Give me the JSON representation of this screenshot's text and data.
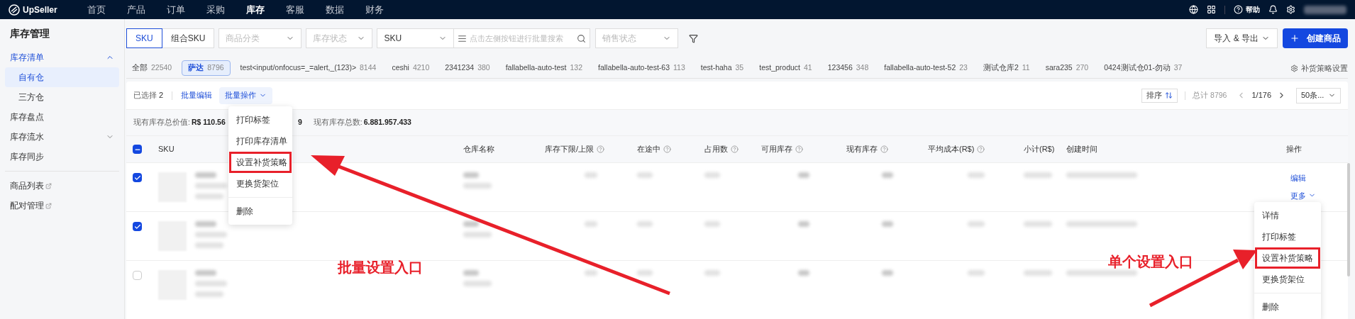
{
  "nav": {
    "logo": "UpSeller",
    "items": [
      {
        "label": "首页",
        "selected": false
      },
      {
        "label": "产品",
        "selected": false
      },
      {
        "label": "订单",
        "selected": false
      },
      {
        "label": "采购",
        "selected": false
      },
      {
        "label": "库存",
        "selected": true
      },
      {
        "label": "客服",
        "selected": false
      },
      {
        "label": "数据",
        "selected": false
      },
      {
        "label": "财务",
        "selected": false
      }
    ],
    "help": "帮助"
  },
  "sidebar": {
    "title": "库存管理",
    "items": [
      {
        "label": "库存清单",
        "selected": true,
        "expanded": true,
        "children": [
          {
            "label": "自有仓",
            "selected": true
          },
          {
            "label": "三方仓",
            "selected": false
          }
        ]
      },
      {
        "label": "库存盘点",
        "selected": false
      },
      {
        "label": "库存流水",
        "selected": false,
        "expanded": false
      },
      {
        "label": "库存同步",
        "selected": false
      }
    ],
    "links": [
      {
        "label": "商品列表",
        "external": true
      },
      {
        "label": "配对管理",
        "external": true
      }
    ]
  },
  "filters": {
    "sku_toggle": [
      {
        "label": "SKU",
        "selected": true
      },
      {
        "label": "组合SKU",
        "selected": false
      }
    ],
    "category": {
      "placeholder": "商品分类"
    },
    "stock_status": {
      "placeholder": "库存状态"
    },
    "search_type": {
      "value": "SKU"
    },
    "search": {
      "placeholder": "点击左侧按钮进行批量搜索"
    },
    "sales_status": {
      "placeholder": "销售状态"
    },
    "import_export": "导入 & 导出",
    "create": "创建商品"
  },
  "warehouse_tabs": [
    {
      "label": "全部",
      "count": "22540",
      "selected": false
    },
    {
      "label": "萨达",
      "count": "8796",
      "selected": true
    },
    {
      "label": "test<input/onfocus=_=alert,_(123)>",
      "count": "8144",
      "selected": false
    },
    {
      "label": "ceshi",
      "count": "4210",
      "selected": false
    },
    {
      "label": "2341234",
      "count": "380",
      "selected": false
    },
    {
      "label": "fallabella-auto-test",
      "count": "132",
      "selected": false
    },
    {
      "label": "fallabella-auto-test-63",
      "count": "113",
      "selected": false
    },
    {
      "label": "test-haha",
      "count": "35",
      "selected": false
    },
    {
      "label": "test_product",
      "count": "41",
      "selected": false
    },
    {
      "label": "123456",
      "count": "348",
      "selected": false
    },
    {
      "label": "fallabella-auto-test-52",
      "count": "23",
      "selected": false
    },
    {
      "label": "测试仓库2",
      "count": "11",
      "selected": false
    },
    {
      "label": "sara235",
      "count": "270",
      "selected": false
    },
    {
      "label": "0424测试仓01-勿动",
      "count": "37",
      "selected": false
    }
  ],
  "strategy_settings": "补货策略设置",
  "toolbar": {
    "selected_label": "已选择",
    "selected_count": "2",
    "batch_edit": "批量编辑",
    "batch_ops": "批量操作",
    "sort": "排序",
    "total": "总计 8796",
    "page": "1/176",
    "page_size": "50条..."
  },
  "stats": {
    "value_label": "现有库存总价值:",
    "value_shown": "R$ 110.56",
    "value_tail": "9",
    "count_label": "现有库存总数:",
    "count": "6.881.957.433"
  },
  "batch_menu": [
    {
      "label": "打印标签",
      "highlighted": false,
      "divider_before": false
    },
    {
      "label": "打印库存清单",
      "highlighted": false,
      "divider_before": false
    },
    {
      "label": "设置补货策略",
      "highlighted": true,
      "divider_before": false
    },
    {
      "label": "更换货架位",
      "highlighted": false,
      "divider_before": false
    },
    {
      "label": "删除",
      "highlighted": false,
      "divider_before": true
    }
  ],
  "table": {
    "header_checked": true,
    "columns": [
      {
        "label": "SKU",
        "help": false
      },
      {
        "label": "仓库名称",
        "help": false
      },
      {
        "label": "库存下限/上限",
        "help": true
      },
      {
        "label": "在途中",
        "help": true
      },
      {
        "label": "占用数",
        "help": true
      },
      {
        "label": "可用库存",
        "help": true
      },
      {
        "label": "现有库存",
        "help": true
      },
      {
        "label": "平均成本(R$)",
        "help": true
      },
      {
        "label": "小计(R$)",
        "help": false
      },
      {
        "label": "创建时间",
        "help": false
      },
      {
        "label": "操作",
        "help": false
      }
    ],
    "rows": [
      {
        "checked": true,
        "actions": [
          "编辑",
          "更多"
        ]
      },
      {
        "checked": true,
        "actions": []
      },
      {
        "checked": false,
        "actions": []
      }
    ]
  },
  "row_menu": [
    {
      "label": "详情",
      "highlighted": false,
      "divider_before": false
    },
    {
      "label": "打印标签",
      "highlighted": false,
      "divider_before": false
    },
    {
      "label": "设置补货策略",
      "highlighted": true,
      "divider_before": false
    },
    {
      "label": "更换货架位",
      "highlighted": false,
      "divider_before": false
    },
    {
      "label": "删除",
      "highlighted": false,
      "divider_before": true
    }
  ],
  "annotations": [
    {
      "label": "批量设置入口"
    },
    {
      "label": "单个设置入口"
    }
  ]
}
